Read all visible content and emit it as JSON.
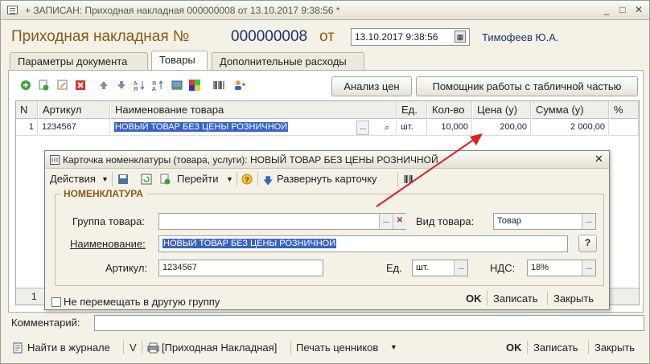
{
  "titlebar": {
    "text": "+ ЗАПИСАН: Приходная накладная 000000008 от 13.10.2017 9:38:56 *",
    "min": "_",
    "restore": "□",
    "close": "✕"
  },
  "header": {
    "title": "Приходная накладная №",
    "number": "000000008",
    "from_label": "от",
    "date": "13.10.2017  9:38:56",
    "author": "Тимофеев Ю.А."
  },
  "tabs": [
    {
      "label": "Параметры документа"
    },
    {
      "label": "Товары"
    },
    {
      "label": "Дополнительные расходы"
    }
  ],
  "toolbar": {
    "analysis_label": "Анализ цен",
    "assistant_label": "Помощник работы с табличной частью"
  },
  "grid": {
    "headers": [
      "N",
      "Артикул",
      "Наименование товара",
      "Ед.",
      "Кол-во",
      "Цена (у)",
      "Сумма (у)",
      "%"
    ],
    "rows": [
      {
        "n": "1",
        "article": "1234567",
        "name": "НОВЫЙ ТОВАР БЕЗ ЦЕНЫ РОЗНИЧНОЙ",
        "unit": "шт.",
        "qty": "10,000",
        "price": "200,00",
        "sum": "2 000,00",
        "pct": ""
      }
    ],
    "footer_n": "1"
  },
  "dialog": {
    "title": "Карточка номенклатуры (товара, услуги): НОВЫЙ ТОВАР БЕЗ ЦЕНЫ РОЗНИЧНОЙ",
    "close": "✕",
    "actions_label": "Действия",
    "goto_label": "Перейти",
    "expand_label": "Развернуть карточку",
    "group_title": "НОМЕНКЛАТУРА",
    "group_label": "Группа товара:",
    "group_value": "",
    "kind_label": "Вид товара:",
    "kind_value": "Товар",
    "name_label": "Наименование:",
    "name_value": "НОВЫЙ ТОВАР БЕЗ ЦЕНЫ РОЗНИЧНОЙ",
    "article_label": "Артикул:",
    "article_value": "1234567",
    "unit_label": "Ед.",
    "unit_value": "шт.",
    "vat_label": "НДС:",
    "vat_value": "18%",
    "help_label": "?",
    "nomove_label": "Не перемещать в другую группу",
    "ok_label": "OK",
    "save_label": "Записать",
    "close_label": "Закрыть"
  },
  "bottom": {
    "comment_label": "Комментарий:",
    "comment_value": "",
    "find_label": "Найти в журнале",
    "v_label": "V",
    "print_label": "[Приходная Накладная]",
    "tags_label": "Печать ценников",
    "ok_label": "OK",
    "save_label": "Записать",
    "close_label": "Закрыть"
  },
  "colors": {
    "accent_title": "#8a5a17",
    "number": "#1e2f73",
    "selection": "#3a63c7",
    "arrow": "#e0202a"
  }
}
